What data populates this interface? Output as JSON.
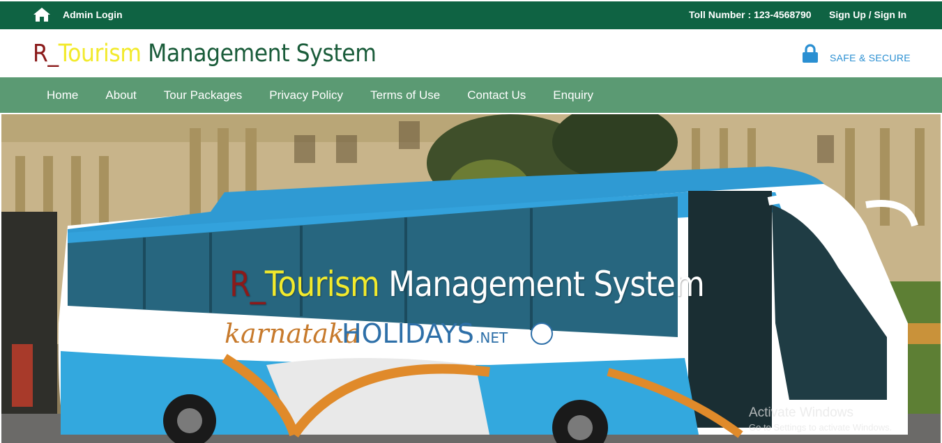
{
  "topbar": {
    "home_icon": "home-icon",
    "admin_login": "Admin Login",
    "toll_number": "Toll Number : 123-4568790",
    "signup_signin": "Sign Up / Sign In"
  },
  "header": {
    "brand_r": "R_",
    "brand_t": "Tourism",
    "brand_m": " Management System",
    "secure_icon": "lock-icon",
    "secure_label": "SAFE & SECURE"
  },
  "nav": {
    "items": [
      "Home",
      "About",
      "Tour Packages",
      "Privacy Policy",
      "Terms of Use",
      "Contact Us",
      "Enquiry"
    ]
  },
  "banner": {
    "title_r": "R_",
    "title_t": "Tourism",
    "title_m": " Management System",
    "bus_text_karnataka": "karnataka",
    "bus_text_holidays": "HOLIDAYS",
    "bus_text_net": ".NET"
  },
  "watermark": {
    "line1": "Activate Windows",
    "line2": "Go to Settings to activate Windows."
  },
  "colors": {
    "topbar": "#0f6343",
    "nav": "#5b9a73",
    "brand_r": "#8b1a1a",
    "brand_t": "#f2ea2c",
    "brand_m": "#1a5c3a",
    "secure": "#2a8fd2"
  }
}
